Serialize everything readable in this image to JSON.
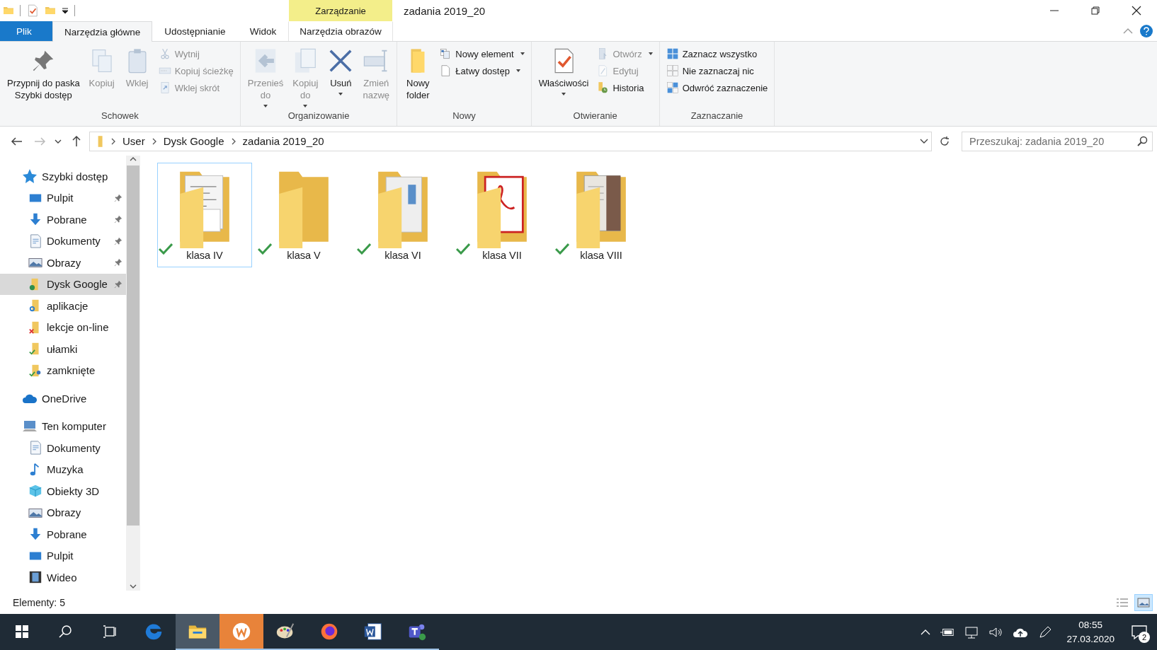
{
  "window": {
    "title": "zadania 2019_20",
    "context_group": "Zarządzanie"
  },
  "tabs": [
    {
      "label": "Plik",
      "kind": "file",
      "selected": false
    },
    {
      "label": "Narzędzia główne",
      "kind": "normal",
      "selected": true
    },
    {
      "label": "Udostępnianie",
      "kind": "normal",
      "selected": false
    },
    {
      "label": "Widok",
      "kind": "normal",
      "selected": false
    },
    {
      "label": "Narzędzia obrazów",
      "kind": "context",
      "selected": false
    }
  ],
  "ribbon": {
    "groups": [
      {
        "label": "Schowek",
        "items": [
          {
            "label": "Przypnij do paska\nSzybki dostęp",
            "kind": "large",
            "disabled": false
          },
          {
            "label": "Kopiuj",
            "kind": "large",
            "disabled": true
          },
          {
            "label": "Wklej",
            "kind": "large",
            "disabled": true
          },
          {
            "label": "Wytnij",
            "kind": "small",
            "disabled": true
          },
          {
            "label": "Kopiuj ścieżkę",
            "kind": "small",
            "disabled": true
          },
          {
            "label": "Wklej skrót",
            "kind": "small",
            "disabled": true
          }
        ]
      },
      {
        "label": "Organizowanie",
        "items": [
          {
            "label": "Przenieś\ndo",
            "kind": "large",
            "disabled": true,
            "dropdown": true
          },
          {
            "label": "Kopiuj\ndo",
            "kind": "large",
            "disabled": true,
            "dropdown": true
          },
          {
            "label": "Usuń",
            "kind": "large",
            "disabled": false,
            "dropdown": true
          },
          {
            "label": "Zmień\nnazwę",
            "kind": "large",
            "disabled": true
          }
        ]
      },
      {
        "label": "Nowy",
        "items": [
          {
            "label": "Nowy\nfolder",
            "kind": "large",
            "disabled": false
          },
          {
            "label": "Nowy element",
            "kind": "small",
            "disabled": false,
            "dropdown": true
          },
          {
            "label": "Łatwy dostęp",
            "kind": "small",
            "disabled": false,
            "dropdown": true
          }
        ]
      },
      {
        "label": "Otwieranie",
        "items": [
          {
            "label": "Właściwości",
            "kind": "large",
            "disabled": false,
            "dropdown": true
          },
          {
            "label": "Otwórz",
            "kind": "small",
            "disabled": true,
            "dropdown": true
          },
          {
            "label": "Edytuj",
            "kind": "small",
            "disabled": true
          },
          {
            "label": "Historia",
            "kind": "small",
            "disabled": false
          }
        ]
      },
      {
        "label": "Zaznaczanie",
        "items": [
          {
            "label": "Zaznacz wszystko",
            "kind": "small",
            "disabled": false
          },
          {
            "label": "Nie zaznaczaj nic",
            "kind": "small",
            "disabled": false
          },
          {
            "label": "Odwróć zaznaczenie",
            "kind": "small",
            "disabled": false
          }
        ]
      }
    ]
  },
  "address_bar": {
    "path": [
      "User",
      "Dysk Google",
      "zadania 2019_20"
    ],
    "search": {
      "placeholder": "Przeszukaj: zadania 2019_20"
    }
  },
  "sidebar": {
    "sections": [
      {
        "label": "Szybki dostęp",
        "selected": false,
        "children": [
          {
            "label": "Pulpit",
            "pinned": true,
            "selected": false
          },
          {
            "label": "Pobrane",
            "pinned": true,
            "selected": false
          },
          {
            "label": "Dokumenty",
            "pinned": true,
            "selected": false
          },
          {
            "label": "Obrazy",
            "pinned": true,
            "selected": false
          },
          {
            "label": "Dysk Google",
            "pinned": true,
            "selected": true
          },
          {
            "label": "aplikacje",
            "pinned": false,
            "selected": false
          },
          {
            "label": "lekcje on-line",
            "pinned": false,
            "selected": false
          },
          {
            "label": "ułamki",
            "pinned": false,
            "selected": false
          },
          {
            "label": "zamknięte",
            "pinned": false,
            "selected": false
          }
        ]
      },
      {
        "label": "OneDrive",
        "selected": false
      },
      {
        "label": "Ten komputer",
        "selected": false,
        "children": [
          {
            "label": "Dokumenty",
            "pinned": false,
            "selected": false
          },
          {
            "label": "Muzyka",
            "pinned": false,
            "selected": false
          },
          {
            "label": "Obiekty 3D",
            "pinned": false,
            "selected": false
          },
          {
            "label": "Obrazy",
            "pinned": false,
            "selected": false
          },
          {
            "label": "Pobrane",
            "pinned": false,
            "selected": false
          },
          {
            "label": "Pulpit",
            "pinned": false,
            "selected": false
          },
          {
            "label": "Wideo",
            "pinned": false,
            "selected": false
          }
        ]
      }
    ]
  },
  "files": [
    {
      "name": "klasa IV",
      "selected": true,
      "synced": true
    },
    {
      "name": "klasa V",
      "selected": false,
      "synced": true
    },
    {
      "name": "klasa VI",
      "selected": false,
      "synced": true
    },
    {
      "name": "klasa VII",
      "selected": false,
      "synced": true
    },
    {
      "name": "klasa VIII",
      "selected": false,
      "synced": true
    }
  ],
  "status_bar": {
    "text": "Elementy: 5",
    "views": [
      {
        "kind": "details",
        "selected": false
      },
      {
        "kind": "large_icons",
        "selected": true
      }
    ]
  },
  "taskbar": {
    "apps": [
      {
        "active": false,
        "running": false
      },
      {
        "active": true,
        "running": true
      },
      {
        "active": false,
        "running": true
      },
      {
        "active": false,
        "running": true
      },
      {
        "active": false,
        "running": true
      },
      {
        "active": false,
        "running": true
      },
      {
        "active": false,
        "running": true
      }
    ],
    "time": "08:55",
    "date": "27.03.2020",
    "notifications": "2"
  }
}
